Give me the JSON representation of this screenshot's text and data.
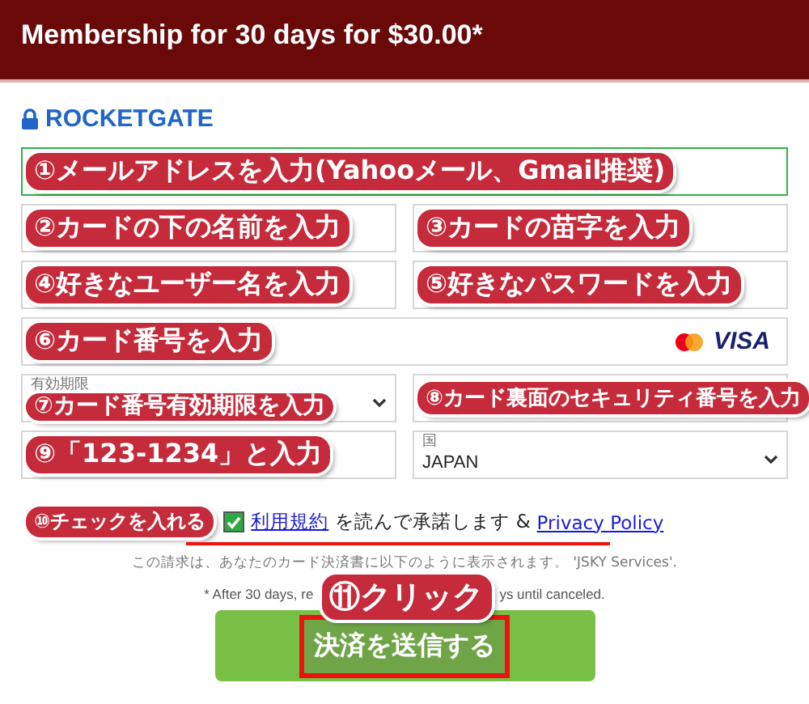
{
  "header": {
    "title": "Membership for 30 days for $30.00*"
  },
  "logo": {
    "text": "ROCKETGATE"
  },
  "rows": [
    [
      {
        "kind": "text",
        "highlighted": true,
        "annotation": "①メールアドレスを入力(Yahooメール、Gmail推奨)"
      }
    ],
    [
      {
        "kind": "text",
        "highlighted": false,
        "annotation": "②カードの下の名前を入力"
      },
      {
        "kind": "text",
        "highlighted": false,
        "annotation": "③カードの苗字を入力"
      }
    ],
    [
      {
        "kind": "text",
        "highlighted": false,
        "annotation": "④好きなユーザー名を入力"
      },
      {
        "kind": "text",
        "highlighted": false,
        "annotation": "⑤好きなパスワードを入力"
      }
    ],
    [
      {
        "kind": "card",
        "highlighted": false,
        "annotation": "⑥カード番号を入力",
        "brand": "VISA"
      }
    ],
    [
      {
        "kind": "select",
        "highlighted": false,
        "label": "有効期限",
        "annotation": "⑦カード番号有効期限を入力"
      },
      {
        "kind": "text",
        "highlighted": false,
        "annotation": "⑧カード裏面のセキュリティ番号を入力",
        "small": true
      }
    ],
    [
      {
        "kind": "text",
        "highlighted": false,
        "annotation": "⑨「123-1234」と入力"
      },
      {
        "kind": "select",
        "highlighted": false,
        "label": "国",
        "value": "JAPAN"
      }
    ]
  ],
  "terms": {
    "annotation": "⑩チェックを入れる",
    "checked": true,
    "link": "利用規約",
    "text": "を読んで承諾します &",
    "policy_link": "Privacy Policy"
  },
  "note": "この請求は、あなたのカード決済書に以下のように表示されます。 'JSKY Services'.",
  "renewal": {
    "before": "* After 30 days, re",
    "after": "ys until canceled.",
    "annotation": "⑪クリック"
  },
  "submit": {
    "label": "決済を送信する"
  }
}
